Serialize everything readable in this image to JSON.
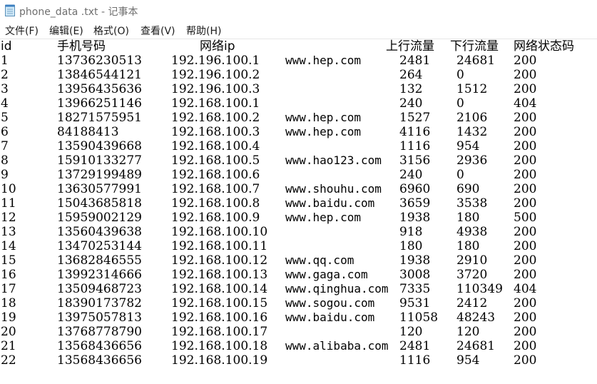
{
  "window": {
    "title": "phone_data .txt - 记事本",
    "icon": "notepad-icon"
  },
  "menu": [
    {
      "label": "文件(F)"
    },
    {
      "label": "编辑(E)"
    },
    {
      "label": "格式(O)"
    },
    {
      "label": "查看(V)"
    },
    {
      "label": "帮助(H)"
    }
  ],
  "table": {
    "headers": [
      "id",
      "手机号码",
      "网络ip",
      "上行流量",
      "下行流量",
      "网络状态码"
    ],
    "rows": [
      [
        "1",
        "13736230513",
        "192.196.100.1",
        "www.hep.com",
        "2481",
        "24681",
        "200"
      ],
      [
        "2",
        "13846544121",
        "192.196.100.2",
        "",
        "264",
        "0",
        "200"
      ],
      [
        "3",
        "13956435636",
        "192.196.100.3",
        "",
        "132",
        "1512",
        "200"
      ],
      [
        "4",
        "13966251146",
        "192.168.100.1",
        "",
        "240",
        "0",
        "404"
      ],
      [
        "5",
        "18271575951",
        "192.168.100.2",
        "www.hep.com",
        "1527",
        "2106",
        "200"
      ],
      [
        "6",
        "84188413",
        "192.168.100.3",
        "www.hep.com",
        "4116",
        "1432",
        "200"
      ],
      [
        "7",
        "13590439668",
        "192.168.100.4",
        "",
        "1116",
        "954",
        "200"
      ],
      [
        "8",
        "15910133277",
        "192.168.100.5",
        "www.hao123.com",
        "3156",
        "2936",
        "200"
      ],
      [
        "9",
        "13729199489",
        "192.168.100.6",
        "",
        "240",
        "0",
        "200"
      ],
      [
        "10",
        "13630577991",
        "192.168.100.7",
        "www.shouhu.com",
        "6960",
        "690",
        "200"
      ],
      [
        "11",
        "15043685818",
        "192.168.100.8",
        "www.baidu.com",
        "3659",
        "3538",
        "200"
      ],
      [
        "12",
        "15959002129",
        "192.168.100.9",
        "www.hep.com",
        "1938",
        "180",
        "500"
      ],
      [
        "13",
        "13560439638",
        "192.168.100.10",
        "",
        "918",
        "4938",
        "200"
      ],
      [
        "14",
        "13470253144",
        "192.168.100.11",
        "",
        "180",
        "180",
        "200"
      ],
      [
        "15",
        "13682846555",
        "192.168.100.12",
        "www.qq.com",
        "1938",
        "2910",
        "200"
      ],
      [
        "16",
        "13992314666",
        "192.168.100.13",
        "www.gaga.com",
        "3008",
        "3720",
        "200"
      ],
      [
        "17",
        "13509468723",
        "192.168.100.14",
        "www.qinghua.com",
        "7335",
        "110349",
        "404"
      ],
      [
        "18",
        "18390173782",
        "192.168.100.15",
        "www.sogou.com",
        "9531",
        "2412",
        "200"
      ],
      [
        "19",
        "13975057813",
        "192.168.100.16",
        "www.baidu.com",
        "11058",
        "48243",
        "200"
      ],
      [
        "20",
        "13768778790",
        "192.168.100.17",
        "",
        "120",
        "120",
        "200"
      ],
      [
        "21",
        "13568436656",
        "192.168.100.18",
        "www.alibaba.com",
        "2481",
        "24681",
        "200"
      ],
      [
        "22",
        "13568436656",
        "192.168.100.19",
        "",
        "1116",
        "954",
        "200"
      ]
    ]
  }
}
